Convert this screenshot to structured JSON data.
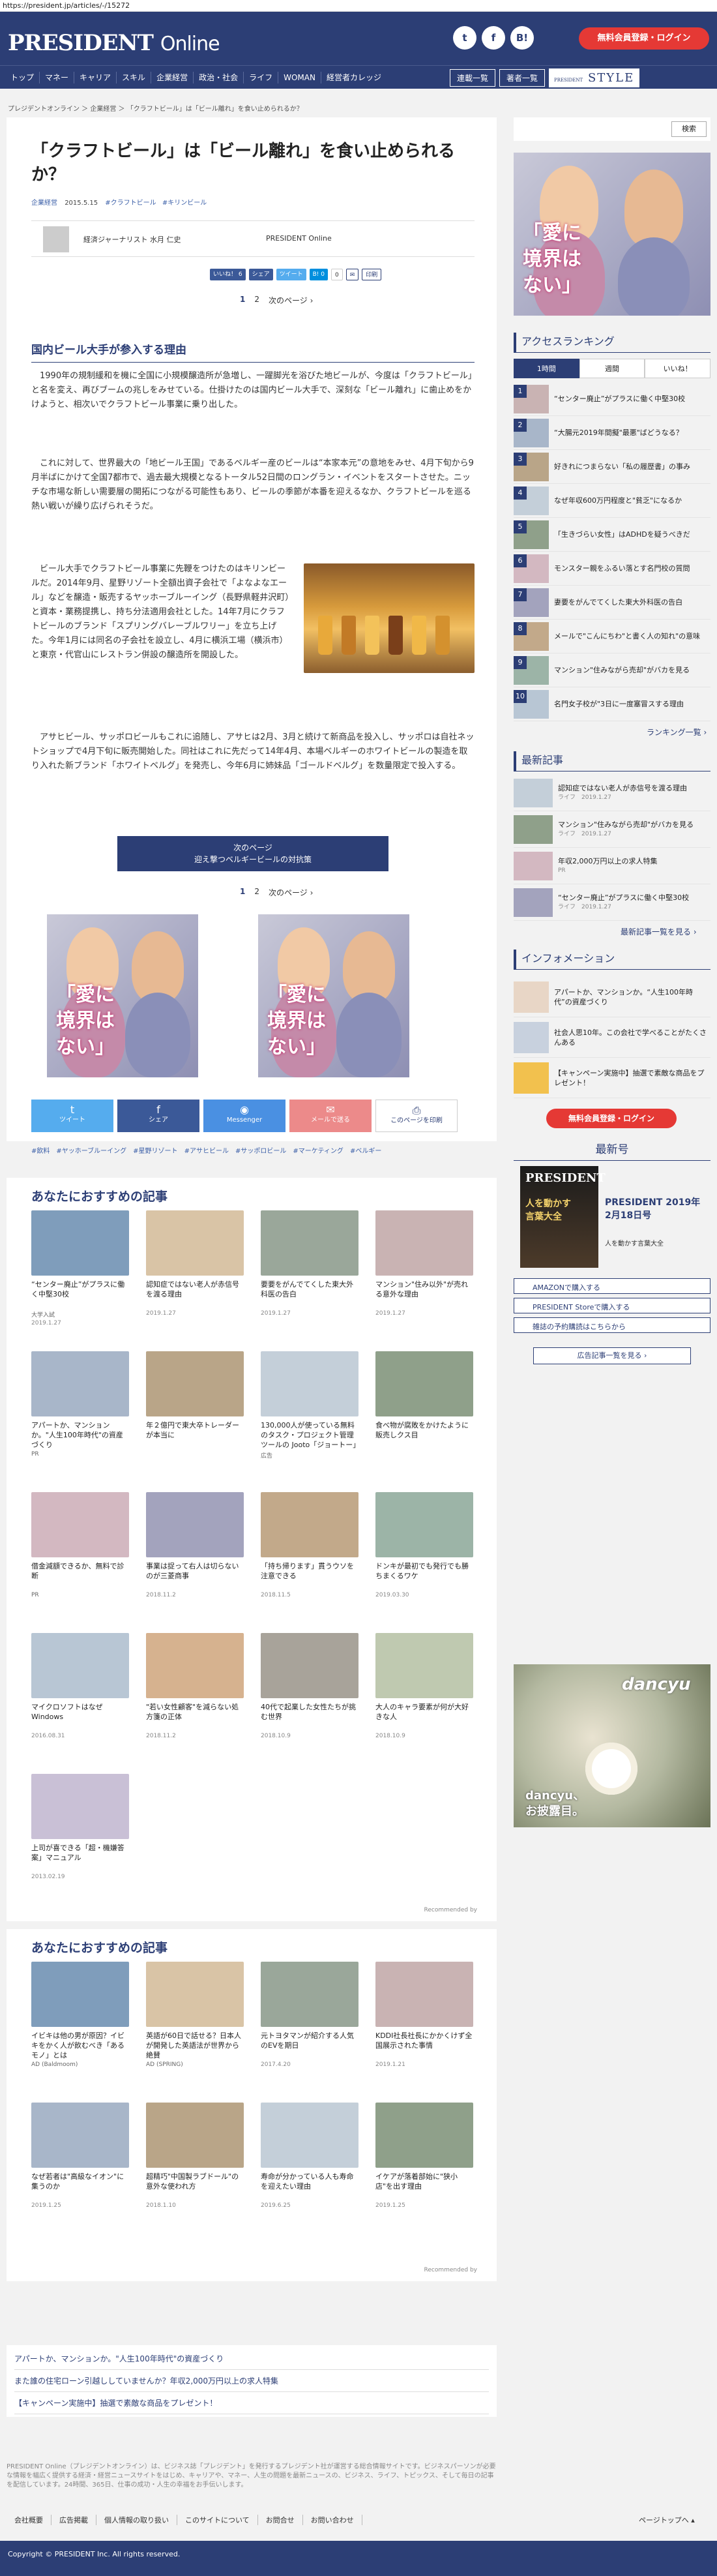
{
  "url": "https://president.jp/articles/-/15272",
  "header": {
    "logo": "PRESIDENT",
    "logo_sub": "Online",
    "social": [
      "t",
      "f",
      "B!"
    ],
    "register_login": "無料会員登録・ログイン"
  },
  "nav": {
    "items": [
      "トップ",
      "マネー",
      "キャリア",
      "スキル",
      "企業経営",
      "政治・社会",
      "ライフ",
      "WOMAN",
      "経営者カレッジ"
    ],
    "right": [
      "連載一覧",
      "著者一覧"
    ],
    "style_label": "PRESIDENT",
    "style": "STYLE"
  },
  "breadcrumb": "プレジデントオンライン ＞ 企業経営 ＞ 「クラフトビール」は「ビール離れ」を食い止められるか？",
  "article": {
    "title": "「クラフトビール」は「ビール離れ」を食い止められるか？",
    "category": "企業経営",
    "date": "2015.5.15",
    "tags_top": [
      "#クラフトビール",
      "#キリンビール"
    ],
    "author": "経済ジャーナリスト 水月 仁史",
    "publisher": "PRESIDENT Online",
    "share": [
      "いいね！ 6",
      "シェア",
      "ツイート",
      "B! 0",
      "0",
      "✉",
      "印刷"
    ],
    "pager": [
      "1",
      "2",
      "次のページ ›"
    ],
    "section": "国内ビール大手が参入する理由",
    "p1": "1990年の規制緩和を機に全国に小規模醸造所が急増し、一躍脚光を浴びた地ビールが、今度は「クラフトビール」と名を変え、再びブームの兆しをみせている。仕掛けたのは国内ビール大手で、深刻な「ビール離れ」に歯止めをかけようと、相次いでクラフトビール事業に乗り出した。",
    "p2": "これに対して、世界最大の「地ビール王国」であるベルギー産のビールは“本家本元”の意地をみせ、4月下旬から9月半ばにかけて全国7都市で、過去最大規模となるトータル52日間のロングラン・イベントをスタートさせた。ニッチな市場な新しい需要層の開拓につながる可能性もあり、ビールの季節が本番を迎えるなか、クラフトビールを巡る熱い戦いが繰り広げられそうだ。",
    "p3": "ビール大手でクラフトビール事業に先鞭をつけたのはキリンビールだ。2014年9月、星野リゾート全額出資子会社で「よなよなエール」などを醸造・販売するヤッホーブルーイング（長野県軽井沢町）と資本・業務提携し、持ち分法適用会社とした。14年7月にクラフトビールのブランド「スプリングバレーブルワリー」を立ち上げた。今年1月には同名の子会社を設立し、4月に横浜工場（横浜市）と東京・代官山にレストラン併設の醸造所を開設した。",
    "p4": "アサヒビール、サッポロビールもこれに追随し、アサヒは2月、3月と続けて新商品を投入し、サッポロは自社ネットショップで4月下旬に販売開始した。同社はこれに先だって14年4月、本場ベルギーのホワイトビールの製造を取り入れた新ブランド「ホワイトベルグ」を発売し、今年6月に姉妹品「ゴールドベルグ」を数量限定で投入する。",
    "next_btn_line1": "次のページ",
    "next_btn_line2": "迎え撃つベルギービールの対抗策"
  },
  "ad": {
    "text_line1": "「愛に",
    "text_line2": "境界は",
    "text_line3": "ない」"
  },
  "share_big": [
    {
      "l1": "ツイート",
      "l2": "",
      "color": "#55acee"
    },
    {
      "l1": "シェア",
      "l2": "",
      "color": "#3b5998"
    },
    {
      "l1": "Messenger",
      "l2": "",
      "color": "#4a90e2"
    },
    {
      "l1": "メールで送る",
      "l2": "",
      "color": "#ec8a8a"
    },
    {
      "l1": "このページを印刷",
      "l2": "",
      "color": "#fff"
    }
  ],
  "tags": [
    "#飲料",
    "#ヤッホーブルーイング",
    "#星野リゾート",
    "#アサヒビール",
    "#サッポロビール",
    "#マーケティング",
    "#ベルギー"
  ],
  "recommend1": {
    "title": "あなたにおすすめの記事",
    "items": [
      {
        "text": "“センター廃止”がプラスに働く中堅30校",
        "src": "大学入試",
        "date": "2019.1.27"
      },
      {
        "text": "認知症ではない老人が赤信号を渡る理由",
        "src": "",
        "date": "2019.1.27"
      },
      {
        "text": "要要をがんでてくした東大外科医の告白",
        "src": "",
        "date": "2019.1.27"
      },
      {
        "text": "マンション\"住み以外\"が売れる意外な理由",
        "src": "",
        "date": "2019.1.27"
      },
      {
        "text": "アパートか、マンションか。\"人生100年時代\"の資産づくり",
        "src": "PR",
        "date": ""
      },
      {
        "text": "年２億円で東大卒トレーダーが本当に",
        "src": "",
        "date": ""
      },
      {
        "text": "130,000人が使っている無料のタスク・プロジェクト管理ツールの Jooto「ジョートー」",
        "src": "広告",
        "date": ""
      },
      {
        "text": "食べ物が腐敗をかけたように販売しクス目",
        "src": "",
        "date": ""
      },
      {
        "text": "借金減額できるか、無料で診断",
        "src": "PR",
        "date": ""
      },
      {
        "text": "事業は捉って右人は切らないのが三菱商事",
        "src": "",
        "date": "2018.11.2"
      },
      {
        "text": "「持ち帰ります」貫うウソを注意できる",
        "src": "",
        "date": "2018.11.5"
      },
      {
        "text": "ドンキが最初でも発行でも勝ちまくるワケ",
        "src": "",
        "date": "2019.03.30"
      },
      {
        "text": "マイクロソフトはなぜWindows",
        "src": "",
        "date": "2016.08.31"
      },
      {
        "text": "\"若い女性顧客\"を減らない処方箋の正体",
        "src": "",
        "date": "2018.11.2"
      },
      {
        "text": "40代で起業した女性たちが挑む世界",
        "src": "",
        "date": "2018.10.9"
      },
      {
        "text": "大人のキャラ要素が何が大好きな人",
        "src": "",
        "date": "2018.10.9"
      },
      {
        "text": "上司が喜できる「超・機嫌答案」マニュアル",
        "src": "",
        "date": "2013.02.19"
      }
    ],
    "credit": "Recommended by"
  },
  "recommend2": {
    "title": "あなたにおすすめの記事",
    "items": [
      {
        "text": "イビキは他の男が原因？イビキをかく人が飲むべき「あるモノ」とは",
        "src": "AD (Baldmoom)",
        "date": ""
      },
      {
        "text": "英語が60日で話せる？日本人が開発した英語法が世界から絶賛",
        "src": "AD (SPRING)",
        "date": ""
      },
      {
        "text": "元トヨタマンが紹介する人気のEVを期日",
        "src": "",
        "date": "2017.4.20"
      },
      {
        "text": "KDDI社長社長にかかくけず全国展示された事情",
        "src": "",
        "date": "2019.1.21"
      },
      {
        "text": "なぜ若者は\"高級なイオン\"に集うのか",
        "src": "",
        "date": "2019.1.25"
      },
      {
        "text": "超精巧\"中国製ラブドール\"の意外な使われ方",
        "src": "",
        "date": "2018.1.10"
      },
      {
        "text": "寿命が分かっている人も寿命を迎えたい理由",
        "src": "",
        "date": "2019.6.25"
      },
      {
        "text": "イケアが落着部始に\"狭小店\"を出す理由",
        "src": "",
        "date": "2019.1.25"
      }
    ],
    "credit": "Recommended by"
  },
  "bottom_links": [
    "アパートか、マンションか。\"人生100年時代\"の資産づくり",
    "また誰の住宅ローン引越ししていませんか？年収2,000万円以上の求人特集",
    "【キャンペーン実施中】抽選で素敵な商品をプレゼント！"
  ],
  "footer_text": "PRESIDENT Online（プレジデントオンライン）は、ビジネス誌「プレジデント」を発行するプレジデント社が運営する総合情報サイトです。ビジネスパーソンが必要な情報を幅広く提供する経済・経営ニュースサイトをはじめ、キャリアや、マネー、人生の問題を最新ニュースの、ビジネス、ライフ、トピックス、そして毎日の記事を配信しています。24時間、365日、仕事の成功・人生の幸福をお手伝いします。",
  "footer_links": [
    "会社概要",
    "広告掲載",
    "個人情報の取り扱い",
    "このサイトについて",
    "お問合せ",
    "お問い合わせ"
  ],
  "pagetop": "ページトップへ ▴",
  "copyright": "Copyright © PRESIDENT Inc. All rights reserved.",
  "sidebar": {
    "search_btn": "検索",
    "ranking_title": "アクセスランキング",
    "ranking_tabs": [
      "1時間",
      "週間",
      "いいね！"
    ],
    "ranking": [
      {
        "num": "1",
        "text": "“センター廃止”がプラスに働く中堅30校"
      },
      {
        "num": "2",
        "text": "“大腸元2019年間擬\"最悪\"ばどうなる？"
      },
      {
        "num": "3",
        "text": "好きれにつまらない「私の履歴書」の事み"
      },
      {
        "num": "4",
        "text": "なぜ年収600万円程度と\"貧乏\"になるか"
      },
      {
        "num": "5",
        "text": "「生きづらい女性」はADHDを疑うべきだ"
      },
      {
        "num": "6",
        "text": "モンスター親をふるい落とす名門校の質問"
      },
      {
        "num": "7",
        "text": "妻要をがんでてくした東大外科医の告白"
      },
      {
        "num": "8",
        "text": "メールで\"こんにちわ\"と書く人の知れ\"の意味"
      },
      {
        "num": "9",
        "text": "マンション\"住みながら売却\"がバカを見る"
      },
      {
        "num": "10",
        "text": "名門女子校が\"3日に一度塞冒",
        "extra": "スする理由"
      }
    ],
    "ranking_more": "ランキング一覧 ›",
    "latest_title": "最新記事",
    "latest": [
      {
        "text": "認知症ではない老人が赤信号を渡る理由",
        "cat": "ライフ　2019.1.27"
      },
      {
        "text": "マンション\"住みながら売却\"がバカを見る",
        "cat": "ライフ　2019.1.27"
      },
      {
        "text": "年収2,000万円以上の求人特集",
        "cat": "PR"
      },
      {
        "text": "“センター廃止”がプラスに働く中堅30校",
        "cat": "ライフ　2019.1.27"
      }
    ],
    "latest_more": "最新記事一覧を見る ›",
    "info_title": "インフォメーション",
    "info": [
      {
        "text": "アパートか、マンションか。“人生100年時代”の資産づくり"
      },
      {
        "text": "社会人思10年。この会社で学べることがたくさんある"
      },
      {
        "text": "【キャンペーン実施中】抽選で素敵な商品をプレゼント！"
      }
    ],
    "register_btn": "無料会員登録・ログイン",
    "mag_title": "最新号",
    "mag_issue": "PRESIDENT 2019年2月18日号",
    "mag_sub": "人を動かす言葉大全",
    "mag_cover_line1": "人を動かす",
    "mag_cover_line2": "言葉大全",
    "mag_btns": [
      "AMAZONで購入する",
      "PRESIDENT Storeで購入する",
      "雑誌の予約購読はこちらから"
    ],
    "mag_list": "広告記事一覧を見る ›",
    "dancyu": "dancyu",
    "dancyu_sub1": "dancyu、",
    "dancyu_sub2": "お披露目。"
  }
}
